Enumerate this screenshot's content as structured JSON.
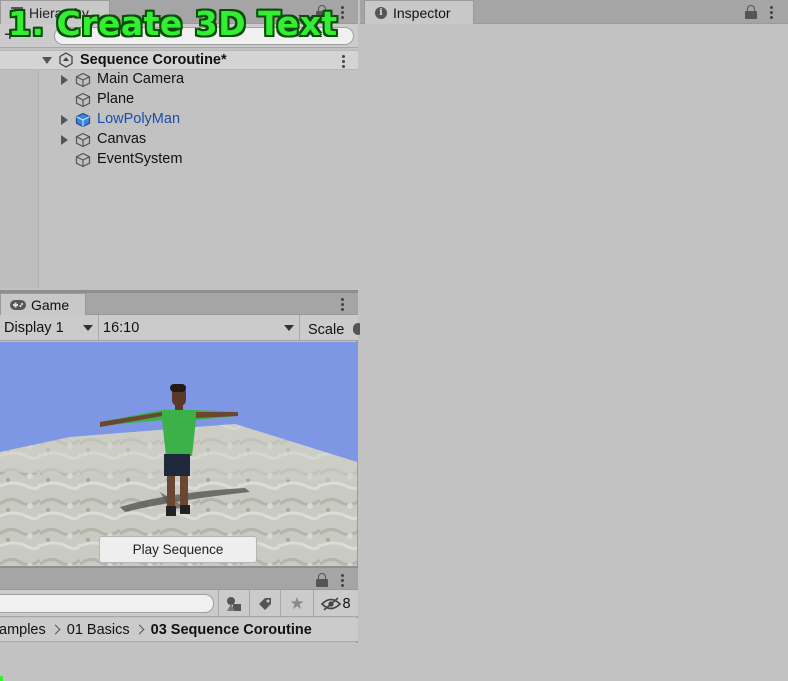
{
  "overlay": {
    "headline": "1. Create 3D Text"
  },
  "hierarchy": {
    "tab_label": "Hierarchy",
    "scene_name": "Sequence Coroutine*",
    "items": [
      {
        "label": "Main Camera",
        "expandable": true
      },
      {
        "label": "Plane",
        "expandable": false
      },
      {
        "label": "LowPolyMan",
        "expandable": true,
        "prefab": true
      },
      {
        "label": "Canvas",
        "expandable": true
      },
      {
        "label": "EventSystem",
        "expandable": false
      }
    ]
  },
  "game": {
    "tab_label": "Game",
    "display": "Display 1",
    "aspect": "16:10",
    "scale_label": "Scale",
    "play_button": "Play Sequence"
  },
  "project": {
    "hidden_count": "8",
    "breadcrumb": [
      "amples",
      "01 Basics",
      "03 Sequence Coroutine"
    ]
  },
  "inspector": {
    "tab_label": "Inspector"
  },
  "colors": {
    "prefab_text": "#1a4fa8",
    "headline": "#33ee33",
    "sky": "#7e97e4"
  }
}
